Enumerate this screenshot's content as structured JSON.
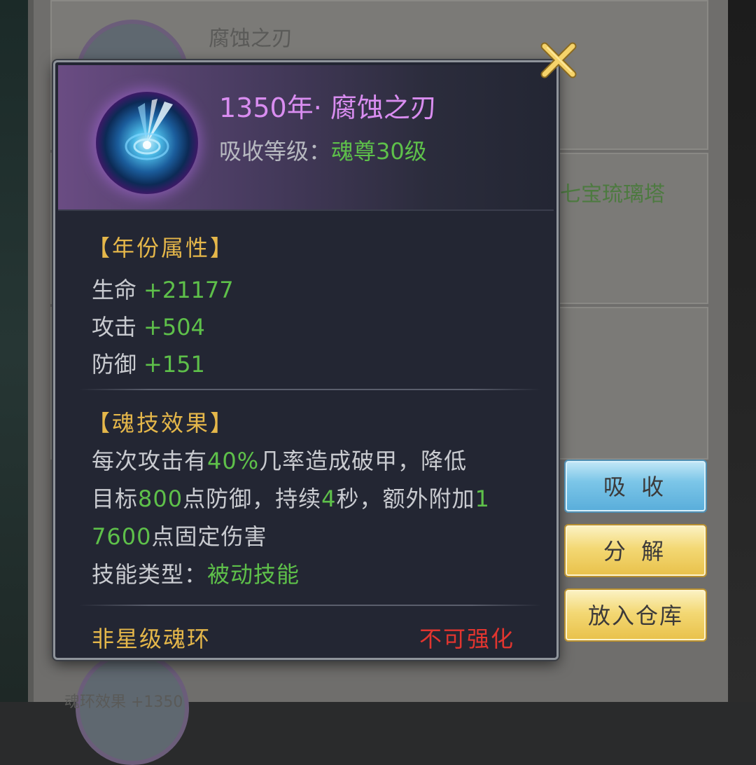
{
  "background": {
    "card_title": "腐蚀之刃",
    "card_green_text": "七宝琉璃塔",
    "bottom_text": "魂环效果 +1350"
  },
  "popup": {
    "title": "1350年·  腐蚀之刃",
    "absorb_label": "吸收等级：",
    "absorb_value": "魂尊30级",
    "year_attr_title": "【年份属性】",
    "stats": [
      {
        "name": "生命",
        "value": "+21177"
      },
      {
        "name": "攻击",
        "value": "+504"
      },
      {
        "name": "防御",
        "value": "+151"
      }
    ],
    "skill_title": "【魂技效果】",
    "skill_lines": [
      [
        "每次攻击有",
        "40%",
        "几率造成破甲，降低"
      ],
      [
        "目标",
        "800",
        "点防御，持续",
        "4",
        "秒，额外附加",
        "1"
      ],
      [
        "7600",
        "点固定伤害"
      ]
    ],
    "skill_type_label": "技能类型：",
    "skill_type_value": "被动技能",
    "footer_left": "非星级魂环",
    "footer_right": "不可强化",
    "close_icon": "close-x-icon"
  },
  "buttons": {
    "absorb": "吸 收",
    "split": "分 解",
    "store": "放入仓库"
  },
  "colors": {
    "title_purple": "#d98df0",
    "highlight_green": "#5ec04a",
    "section_gold": "#e5b74a",
    "warning_red": "#e2352f"
  }
}
